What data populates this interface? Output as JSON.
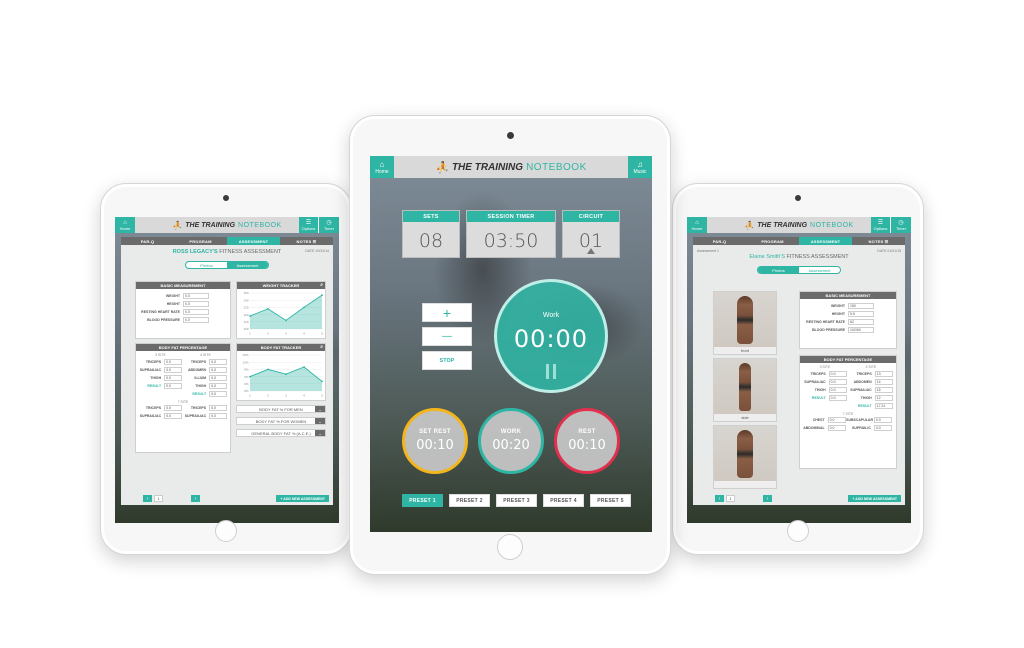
{
  "brand": {
    "bold": "THE TRAINING",
    "light": "NOTEBOOK"
  },
  "colors": {
    "accent": "#2fb5a4",
    "rest_ring": "#e0304e",
    "set_rest_ring": "#f2b51c"
  },
  "center": {
    "home_label": "Home",
    "music_label": "Music",
    "sets": {
      "label": "SETS",
      "value": "08"
    },
    "session_timer": {
      "label": "SESSION TIMER",
      "value": "03:50"
    },
    "circuit": {
      "label": "CIRCUIT",
      "value": "01"
    },
    "controls": {
      "plus": "+",
      "minus": "—",
      "stop": "STOP"
    },
    "work_circle": {
      "label": "Work",
      "time": "00:00"
    },
    "set_rest": {
      "label": "SET REST",
      "time": "00:10"
    },
    "work": {
      "label": "WORK",
      "time": "00:20"
    },
    "rest": {
      "label": "REST",
      "time": "00:10"
    },
    "presets": [
      "PRESET 1",
      "PRESET 2",
      "PRESET 3",
      "PRESET 4",
      "PRESET 5"
    ]
  },
  "left": {
    "home_label": "Home",
    "options_label": "Options",
    "timer_label": "Timer",
    "tabs": [
      "PAR-Q",
      "PROGRAM",
      "ASSESSMENT",
      "NOTES ☰"
    ],
    "title_name": "ROSS LEGACY'S",
    "title_rest": " FITNESS ASSESSMENT",
    "date": "DATE 10/31/14",
    "seg": [
      "Photos",
      "Assessment"
    ],
    "basic": {
      "title": "BASIC MEASUREMENT",
      "rows": [
        {
          "label": "WEIGHT",
          "value": "0.0"
        },
        {
          "label": "HEIGHT",
          "value": "0.0"
        },
        {
          "label": "RESTING HEART RATE",
          "value": "0.0"
        },
        {
          "label": "BLOOD PRESSURE",
          "value": "0.0"
        }
      ]
    },
    "weight_tracker": {
      "title": "WEIGHT TRACKER",
      "y_ticks": [
        "150",
        "140",
        "130",
        "120",
        "110",
        "100"
      ],
      "x_ticks": [
        "1",
        "2",
        "3",
        "4",
        "5"
      ],
      "values": [
        118,
        128,
        112,
        130,
        147
      ]
    },
    "bodyfat": {
      "title": "BODY FAT PERCENTAGE",
      "sec_a": "3 SITE",
      "sec_b": "4 SITE",
      "sec_c": "7 SITE",
      "col_a": [
        {
          "label": "TRICEPS",
          "value": "0.0"
        },
        {
          "label": "SUPRAILIAC",
          "value": "0.0"
        },
        {
          "label": "THIGH",
          "value": "0.0"
        },
        {
          "label": "RESULT",
          "value": "0.0"
        }
      ],
      "col_b": [
        {
          "label": "TRICEPS",
          "value": "0.0"
        },
        {
          "label": "ABDOMEN",
          "value": "0.0"
        },
        {
          "label": "ILLIUM",
          "value": "0.0"
        },
        {
          "label": "THIGH",
          "value": "0.0"
        },
        {
          "label": "RESULT",
          "value": "0.0"
        }
      ],
      "col_c": [
        {
          "label": "TRICEPS",
          "value": "0.0"
        },
        {
          "label": "SUPRAILIAC",
          "value": "0.0"
        }
      ],
      "col_d": [
        {
          "label": "TRICEPS",
          "value": "0.0"
        },
        {
          "label": "SUPRAILIAC",
          "value": "0.0"
        }
      ]
    },
    "bodyfat_tracker": {
      "title": "BODY FAT TRACKER",
      "y_ticks": [
        "15%",
        "12%",
        "9%",
        "6%",
        "3%",
        "0%"
      ],
      "x_ticks": [
        "1",
        "2",
        "3",
        "4",
        "5"
      ],
      "values": [
        6,
        9,
        7,
        10,
        4
      ]
    },
    "dropdowns": [
      "BODY FAT % FOR MEN",
      "BODY FAT % FOR WOMEN",
      "GENERAL BODY FAT % (A.C.E.)"
    ],
    "page": "1",
    "add_label": "+ ADD NEW ASSESSMENT"
  },
  "right": {
    "home_label": "Home",
    "options_label": "Options",
    "timer_label": "Timer",
    "tabs": [
      "PAR-Q",
      "PROGRAM",
      "ASSESSMENT",
      "NOTES ☰"
    ],
    "subtitle": "Assessment 1",
    "title_name": "Elaine Smith'S",
    "title_rest": " FITNESS ASSESSMENT",
    "date": "DATE 01/01/15",
    "seg": [
      "Photos",
      "Assessment"
    ],
    "photos": [
      "front",
      "side",
      ""
    ],
    "basic": {
      "title": "BASIC MEASUREMENT",
      "rows": [
        {
          "label": "WEIGHT",
          "value": "150"
        },
        {
          "label": "HEIGHT",
          "value": "5.5"
        },
        {
          "label": "RESTING HEART RATE",
          "value": "62"
        },
        {
          "label": "BLOOD PRESSURE",
          "value": "102/60"
        }
      ]
    },
    "bodyfat": {
      "title": "BODY FAT PERCENTAGE",
      "sec_a": "3 SITE",
      "sec_b": "4 SITE",
      "sec_c": "7 SITE",
      "col_a": [
        {
          "label": "TRICEPS",
          "value": "0.0"
        },
        {
          "label": "SUPRAILIAC",
          "value": "0.0"
        },
        {
          "label": "THIGH",
          "value": "0.0"
        },
        {
          "label": "RESULT",
          "value": "0.0"
        }
      ],
      "col_b": [
        {
          "label": "TRICEPS",
          "value": "13"
        },
        {
          "label": "ABDOMEN",
          "value": "14"
        },
        {
          "label": "SUPRAILIAC",
          "value": "15"
        },
        {
          "label": "THIGH",
          "value": "12"
        },
        {
          "label": "RESULT",
          "value": "17.21"
        }
      ],
      "col_c": [
        {
          "label": "CHEST",
          "value": "0.0"
        },
        {
          "label": "ABDOMINAL",
          "value": "0.0"
        }
      ],
      "col_d": [
        {
          "label": "SUBSCAPULAR",
          "value": "0.0"
        },
        {
          "label": "SUPRAILIC",
          "value": "0.0"
        }
      ]
    },
    "page": "1",
    "add_label": "+ ADD NEW ASSESSMENT"
  }
}
